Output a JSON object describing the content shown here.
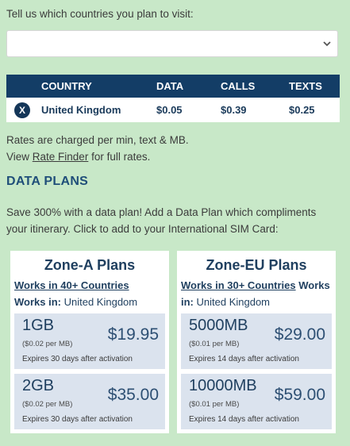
{
  "prompt": "Tell us which countries you plan to visit:",
  "select": {
    "value": ""
  },
  "rates_table": {
    "headers": [
      "COUNTRY",
      "DATA",
      "CALLS",
      "TEXTS"
    ],
    "remove_label": "X",
    "rows": [
      {
        "country": "United Kingdom",
        "data": "$0.05",
        "calls": "$0.39",
        "texts": "$0.25"
      }
    ]
  },
  "notes": {
    "line1": "Rates are charged per min, text & MB.",
    "line2_prefix": "View ",
    "line2_link": "Rate Finder",
    "line2_suffix": " for full rates."
  },
  "data_plans": {
    "heading": "DATA PLANS",
    "intro": "Save 300% with a data plan! Add a Data Plan which compliments your itinerary. Click to add to your International SIM Card:",
    "zones": [
      {
        "title": "Zone-A Plans",
        "works_link": "Works in 40+ Countries",
        "works_in_label": "Works in:",
        "works_in_value": " United Kingdom",
        "plans": [
          {
            "size": "1GB",
            "per": "($0.02 per MB)",
            "price": "$19.95",
            "expires": "Expires 30 days after activation"
          },
          {
            "size": "2GB",
            "per": "($0.02 per MB)",
            "price": "$35.00",
            "expires": "Expires 30 days after activation"
          }
        ]
      },
      {
        "title": "Zone-EU Plans",
        "works_link": "Works in 30+ Countries",
        "works_in_label": "Works in:",
        "works_in_value": " United Kingdom",
        "plans": [
          {
            "size": "5000MB",
            "per": "($0.01 per MB)",
            "price": "$29.00",
            "expires": "Expires 14 days after activation"
          },
          {
            "size": "10000MB",
            "per": "($0.01 per MB)",
            "price": "$59.00",
            "expires": "Expires 14 days after activation"
          }
        ]
      }
    ]
  }
}
